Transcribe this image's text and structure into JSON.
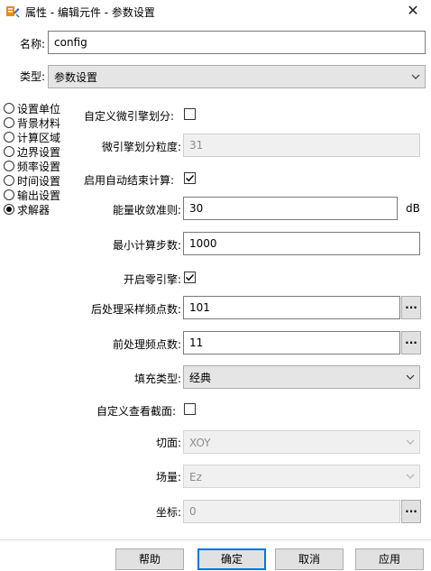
{
  "window": {
    "title": "属性 - 编辑元件 - 参数设置",
    "close_glyph": "✕"
  },
  "name_field": {
    "label": "名称:",
    "value": "config"
  },
  "type_field": {
    "label": "类型:",
    "value": "参数设置"
  },
  "nav": {
    "items": [
      {
        "label": "设置单位",
        "selected": false
      },
      {
        "label": "背景材料",
        "selected": false
      },
      {
        "label": "计算区域",
        "selected": false
      },
      {
        "label": "边界设置",
        "selected": false
      },
      {
        "label": "频率设置",
        "selected": false
      },
      {
        "label": "时间设置",
        "selected": false
      },
      {
        "label": "输出设置",
        "selected": false
      },
      {
        "label": "求解器",
        "selected": true
      }
    ]
  },
  "solver": {
    "custom_engine_split": {
      "label": "自定义微引擎划分:",
      "checked": false
    },
    "engine_granularity": {
      "label": "微引擎划分粒度:",
      "value": "31",
      "enabled": false
    },
    "auto_end": {
      "label": "启用自动结束计算:",
      "checked": true
    },
    "energy_criterion": {
      "label": "能量收敛准则:",
      "value": "30",
      "unit": "dB"
    },
    "min_steps": {
      "label": "最小计算步数:",
      "value": "1000"
    },
    "zero_engine": {
      "label": "开启零引擎:",
      "checked": true
    },
    "post_freq_points": {
      "label": "后处理采样频点数:",
      "value": "101",
      "button": "..."
    },
    "pre_freq_points": {
      "label": "前处理频点数:",
      "value": "11",
      "button": "..."
    },
    "fill_type": {
      "label": "填充类型:",
      "value": "经典"
    },
    "custom_section": {
      "label": "自定义查看截面:",
      "checked": false
    },
    "plane": {
      "label": "切面:",
      "value": "XOY",
      "enabled": false
    },
    "field": {
      "label": "场量:",
      "value": "Ez",
      "enabled": false
    },
    "coord": {
      "label": "坐标:",
      "value": "0",
      "button": "...",
      "enabled": false
    }
  },
  "footer": {
    "help": "帮助",
    "ok": "确定",
    "cancel": "取消",
    "apply": "应用"
  },
  "colors": {
    "accent": "#0078d7",
    "icon_orange": "#e8891f",
    "icon_blue": "#2a6fc9"
  }
}
